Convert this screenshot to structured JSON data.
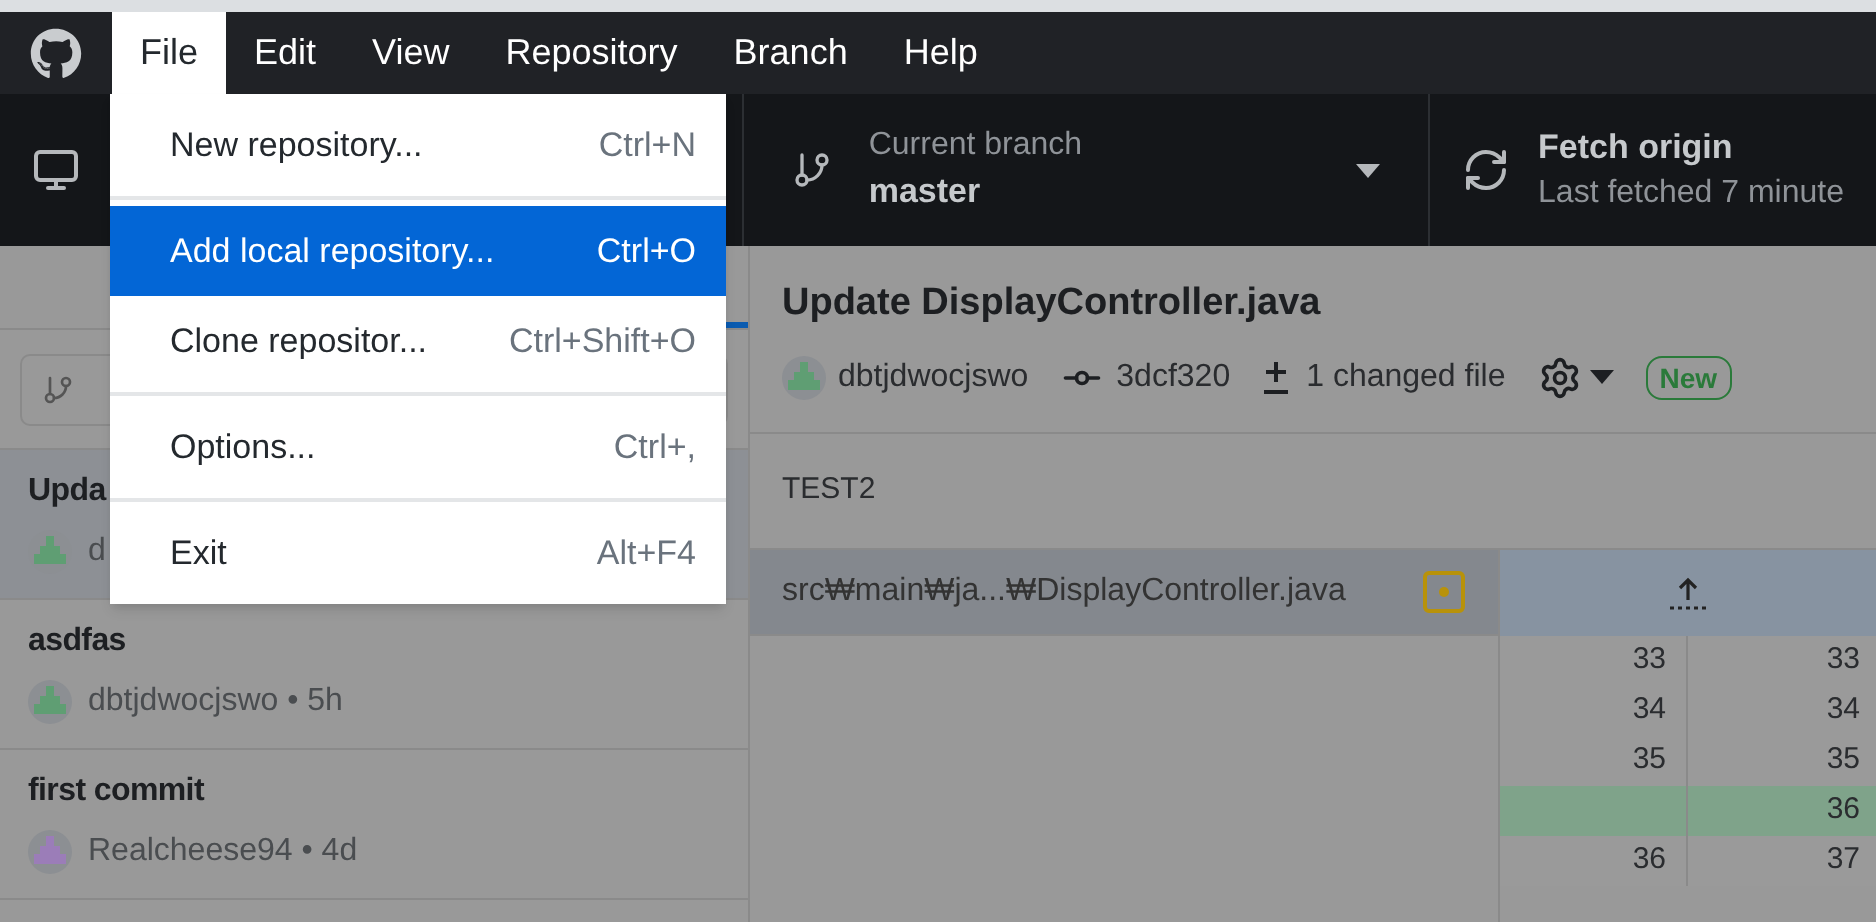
{
  "menubar": {
    "items": [
      {
        "label": "File",
        "selected": true
      },
      {
        "label": "Edit",
        "selected": false
      },
      {
        "label": "View",
        "selected": false
      },
      {
        "label": "Repository",
        "selected": false
      },
      {
        "label": "Branch",
        "selected": false
      },
      {
        "label": "Help",
        "selected": false
      }
    ]
  },
  "file_menu": {
    "groups": [
      [
        {
          "label": "New repository...",
          "shortcut": "Ctrl+N",
          "selected": false
        }
      ],
      [
        {
          "label": "Add local repository...",
          "shortcut": "Ctrl+O",
          "selected": true
        },
        {
          "label": "Clone repositor...",
          "shortcut": "Ctrl+Shift+O",
          "selected": false
        }
      ],
      [
        {
          "label": "Options...",
          "shortcut": "Ctrl+,",
          "selected": false
        }
      ],
      [
        {
          "label": "Exit",
          "shortcut": "Alt+F4",
          "selected": false
        }
      ]
    ]
  },
  "toolbar": {
    "branch": {
      "label": "Current branch",
      "value": "master"
    },
    "fetch": {
      "label": "Fetch origin",
      "detail": "Last fetched 7 minute"
    }
  },
  "history": {
    "commits": [
      {
        "title": "Upda",
        "meta": "d",
        "selected": true,
        "color": "#5f9e73"
      },
      {
        "title": "asdfas",
        "meta": "dbtjdwocjswo • 5h",
        "selected": false,
        "color": "#5f9e73"
      },
      {
        "title": "first commit",
        "meta": "Realcheese94 • 4d",
        "selected": false,
        "color": "#9b7db8"
      }
    ]
  },
  "commit": {
    "title": "Update DisplayController.java",
    "author": "dbtjdwocjswo",
    "sha": "3dcf320",
    "changed": "1 changed file",
    "badge": "New",
    "message": "TEST2"
  },
  "files": [
    {
      "path": "src₩main₩ja...₩DisplayController.java",
      "selected": true
    }
  ],
  "diff": {
    "rows": [
      {
        "kind": "context",
        "old": "33",
        "new": "33"
      },
      {
        "kind": "context",
        "old": "34",
        "new": "34"
      },
      {
        "kind": "context",
        "old": "35",
        "new": "35"
      },
      {
        "kind": "added",
        "new": "36"
      },
      {
        "kind": "context",
        "old": "36",
        "new": "37"
      }
    ]
  }
}
